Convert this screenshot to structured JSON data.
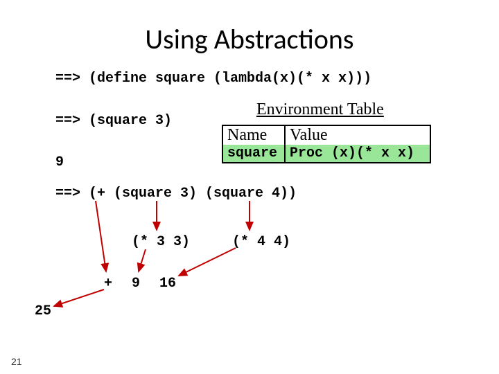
{
  "title": "Using Abstractions",
  "lines": {
    "define": "==> (define square (lambda(x)(* x x)))",
    "call": "==> (square 3)",
    "result9": "9",
    "expr": "==> (+ (square 3) (square 4))",
    "red1": "(* 3 3)",
    "red2": "(* 4 4)",
    "plus": "+",
    "nine": "9",
    "sixteen": "16",
    "twentyfive": "25"
  },
  "env": {
    "title": "Environment Table",
    "head_name": "Name",
    "head_value": "Value",
    "row_name": "square",
    "row_value": "Proc (x)(* x x)"
  },
  "slide_number": "21"
}
